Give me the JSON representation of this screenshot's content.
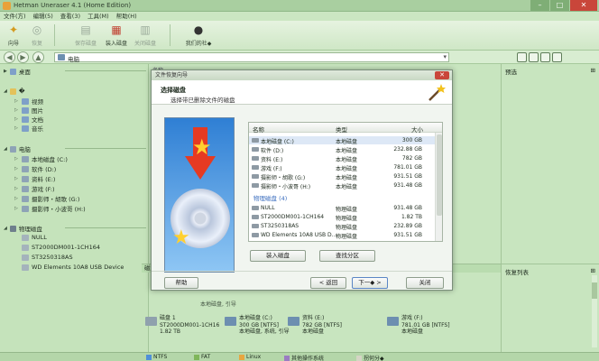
{
  "window": {
    "title": "Hetman Uneraser 4.1 (Home Edition)"
  },
  "menu": [
    "文件(方)",
    "编辑(5)",
    "查看(3)",
    "工具(M)",
    "帮助(H)"
  ],
  "toolbar": {
    "wizard": "向导",
    "recover": "恢复",
    "save_disk": "保存磁盘",
    "mount_disk": "装入磁盘",
    "close_disk": "关闭磁盘",
    "about": "我们的社◆"
  },
  "address": {
    "value": "电脑"
  },
  "left": {
    "desktop": "桌面",
    "user": "�",
    "user_items": [
      "视频",
      "图片",
      "文档",
      "音乐"
    ],
    "computer": "电脑",
    "computer_items": [
      "本地磁盘 (C:)",
      "软件 (D:)",
      "资料 (E:)",
      "游戏 (F:)",
      "摄影师・胡歌 (G:)",
      "摄影师・小波哥 (H:)"
    ],
    "physical": "物理磁盘",
    "physical_items": [
      "NULL",
      "ST2000DM001-1CH164",
      "ST3250318AS",
      "WD Elements 10A8 USB Device"
    ]
  },
  "main": {
    "header": "名称"
  },
  "right": {
    "title": "预选",
    "recovery_list": "恢复列表"
  },
  "dialog": {
    "caption": "文件恢复向导",
    "heading": "选择磁盘",
    "subheading": "选择带已删除文件的磁盘",
    "columns": {
      "name": "名称",
      "type": "类型",
      "size": "大小"
    },
    "rows": [
      {
        "name": "本地磁盘 (C:)",
        "type": "本地磁盘",
        "size": "300 GB"
      },
      {
        "name": "软件 (D:)",
        "type": "本地磁盘",
        "size": "232.88 GB"
      },
      {
        "name": "资料 (E:)",
        "type": "本地磁盘",
        "size": "782 GB"
      },
      {
        "name": "游戏 (F:)",
        "type": "本地磁盘",
        "size": "781.01 GB"
      },
      {
        "name": "摄影师・胡歌 (G:)",
        "type": "本地磁盘",
        "size": "931.51 GB"
      },
      {
        "name": "摄影师・小波哥 (H:)",
        "type": "本地磁盘",
        "size": "931.48 GB"
      }
    ],
    "group2": "物理磁盘 (4)",
    "rows2": [
      {
        "name": "NULL",
        "type": "物理磁盘",
        "size": "931.48 GB"
      },
      {
        "name": "ST2000DM001-1CH164",
        "type": "物理磁盘",
        "size": "1.82 TB"
      },
      {
        "name": "ST3250318AS",
        "type": "物理磁盘",
        "size": "232.89 GB"
      },
      {
        "name": "WD Elements 10A8 USB D...",
        "type": "物理磁盘",
        "size": "931.51 GB"
      }
    ],
    "mount_btn": "装入磁盘",
    "find_btn": "查找分区",
    "help_btn": "帮助",
    "back_btn": "< 返回",
    "next_btn": "下一◆ >",
    "close_btn": "关闭"
  },
  "lower": {
    "header": "磁",
    "sub": "本地磁盘, 引导",
    "disk1": {
      "name": "磁盘 1",
      "model": "ST2000DM001-1CH16",
      "size": "1.82 TB"
    },
    "c": {
      "name": "本地磁盘 (C:)",
      "info": "300 GB [NTFS]",
      "sub": "本地磁盘, 系统, 引导"
    },
    "e": {
      "name": "资料 (E:)",
      "info": "782 GB [NTFS]",
      "sub": "本地磁盘"
    },
    "f": {
      "name": "游戏 (F:)",
      "info": "781.01 GB [NTFS]",
      "sub": "本地磁盘"
    }
  },
  "legend": [
    "NTFS",
    "FAT",
    "Linux",
    "其他操作系统",
    "拐何分◆"
  ],
  "colors": {
    "ntfs": "#4f8fd8",
    "fat": "#7fb65a",
    "linux": "#e7a640",
    "other": "#9a7cc2",
    "unalloc": "#d5d5c5"
  }
}
